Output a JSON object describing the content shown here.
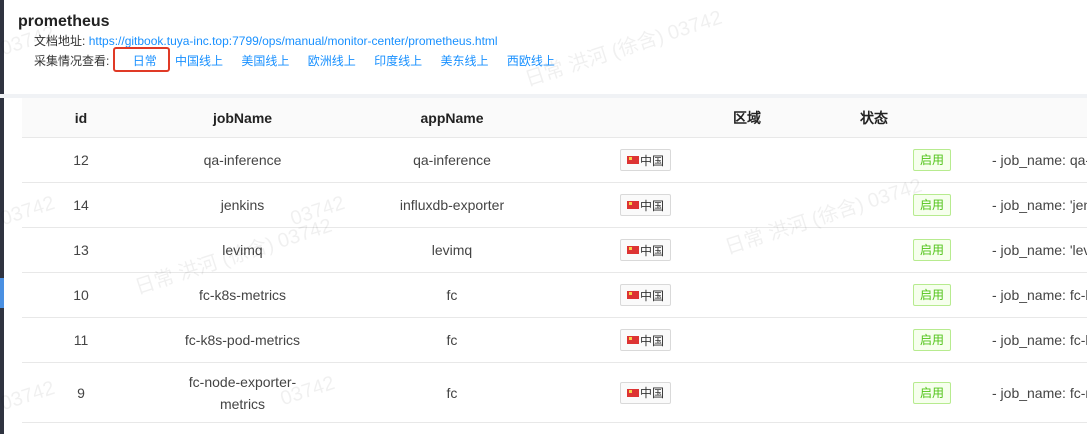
{
  "page": {
    "title": "prometheus"
  },
  "doc": {
    "label": "文档地址:",
    "url": "https://gitbook.tuya-inc.top:7799/ops/manual/monitor-center/prometheus.html"
  },
  "env": {
    "label": "采集情况查看:",
    "links": [
      "日常",
      "中国线上",
      "美国线上",
      "欧洲线上",
      "印度线上",
      "美东线上",
      "西欧线上"
    ],
    "highlight_color": "#e03a26"
  },
  "table": {
    "headers": [
      "id",
      "jobName",
      "appName",
      "区域",
      "状态"
    ],
    "rows": [
      {
        "id": "12",
        "jobName": "qa-inference",
        "appName": "qa-inference",
        "region": "中国",
        "status": "启用",
        "desc": "- job_name: qa-i"
      },
      {
        "id": "14",
        "jobName": "jenkins",
        "appName": "influxdb-exporter",
        "region": "中国",
        "status": "启用",
        "desc": "- job_name: 'jenl"
      },
      {
        "id": "13",
        "jobName": "levimq",
        "appName": "levimq",
        "region": "中国",
        "status": "启用",
        "desc": "- job_name: 'levi"
      },
      {
        "id": "10",
        "jobName": "fc-k8s-metrics",
        "appName": "fc",
        "region": "中国",
        "status": "启用",
        "desc": "- job_name: fc-k"
      },
      {
        "id": "11",
        "jobName": "fc-k8s-pod-metrics",
        "appName": "fc",
        "region": "中国",
        "status": "启用",
        "desc": "- job_name: fc-k"
      },
      {
        "id": "9",
        "jobName": "fc-node-exporter-metrics",
        "appName": "fc",
        "region": "中国",
        "status": "启用",
        "desc": "- job_name: fc-r"
      }
    ]
  },
  "watermark": {
    "text_a": "日常 洪河 (徐含) 03742",
    "text_b": "03742"
  },
  "colors": {
    "link": "#1890ff",
    "status_green": "#52c41a"
  },
  "icons": {
    "flag": "china-flag-icon"
  }
}
